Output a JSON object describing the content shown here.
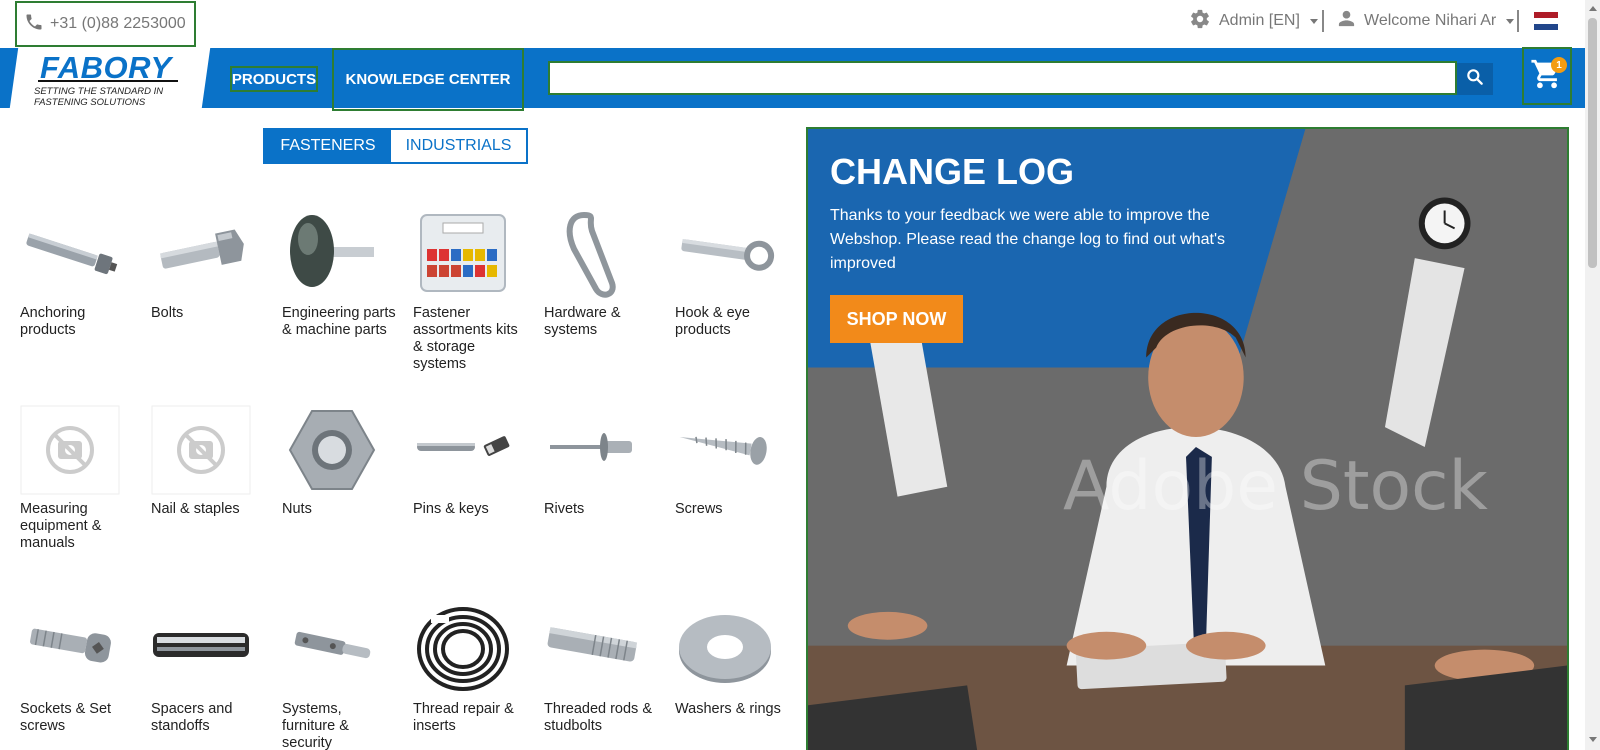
{
  "topbar": {
    "phone": "+31 (0)88 2253000",
    "admin": "Admin [EN]",
    "welcome": "Welcome Nihari Ar"
  },
  "logo": {
    "name": "FABORY",
    "tagline": "SETTING THE STANDARD IN FASTENING SOLUTIONS"
  },
  "nav": {
    "products": "PRODUCTS",
    "knowledge_center": "KNOWLEDGE CENTER"
  },
  "search": {
    "value": "",
    "placeholder": ""
  },
  "cart": {
    "count": "1"
  },
  "toggle": {
    "fasteners": "FASTENERS",
    "industrials": "INDUSTRIALS"
  },
  "products": [
    "Anchoring products",
    "Bolts",
    "Engineering parts & machine parts",
    "Fastener assortments kits & storage systems",
    "Hardware & systems",
    "Hook & eye products",
    "Measuring equipment & manuals",
    "Nail & staples",
    "Nuts",
    "Pins & keys",
    "Rivets",
    "Screws",
    "Sockets & Set screws",
    "Spacers and standoffs",
    "Systems, furniture & security",
    "Thread repair & inserts",
    "Threaded rods & studbolts",
    "Washers & rings"
  ],
  "banner": {
    "title": "CHANGE LOG",
    "text": "Thanks to your feedback we were able to improve the Webshop. Please read the change log to find out what's improved",
    "cta": "SHOP NOW",
    "watermark": "Adobe Stock"
  },
  "colors": {
    "brand_blue": "#0a72c8",
    "cta_orange": "#f28a1a",
    "highlight_green": "#2e7d32",
    "badge_orange": "#f39c12"
  }
}
